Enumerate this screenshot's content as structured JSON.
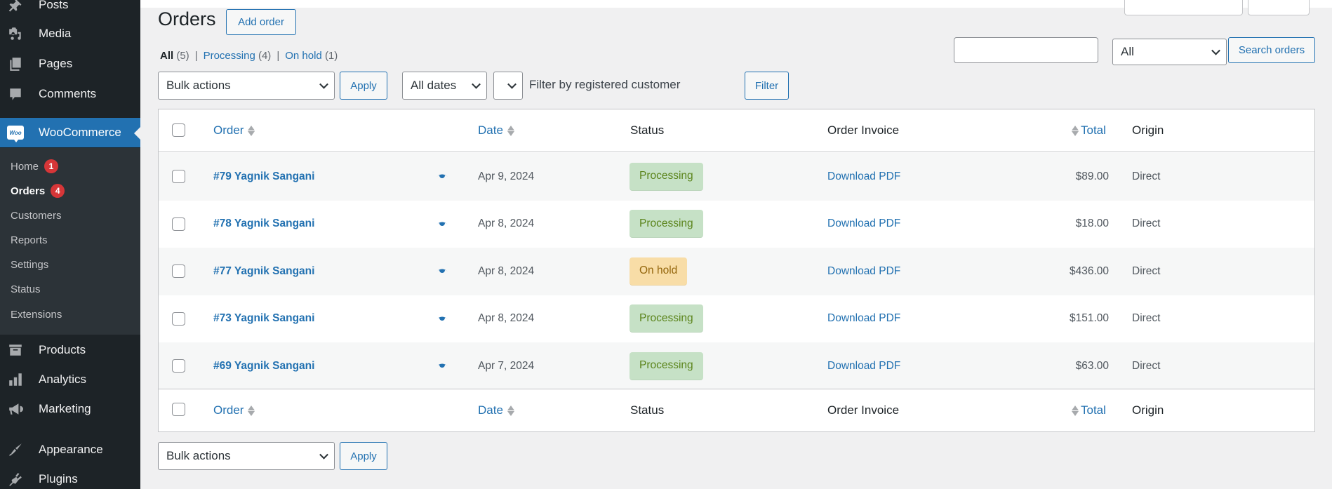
{
  "sidebar": {
    "items_top": [
      {
        "label": "Posts",
        "icon": "pushpin-icon"
      },
      {
        "label": "Media",
        "icon": "media-icon"
      },
      {
        "label": "Pages",
        "icon": "pages-icon"
      },
      {
        "label": "Comments",
        "icon": "comment-icon"
      }
    ],
    "active": {
      "label": "WooCommerce",
      "icon": "woocommerce-icon",
      "logo_text": "Woo"
    },
    "submenu": [
      {
        "label": "Home",
        "badge": "1"
      },
      {
        "label": "Orders",
        "badge": "4",
        "current": true
      },
      {
        "label": "Customers"
      },
      {
        "label": "Reports"
      },
      {
        "label": "Settings"
      },
      {
        "label": "Status"
      },
      {
        "label": "Extensions"
      }
    ],
    "items_bottom": [
      {
        "label": "Products",
        "icon": "archive-icon"
      },
      {
        "label": "Analytics",
        "icon": "bar-chart-icon"
      },
      {
        "label": "Marketing",
        "icon": "megaphone-icon"
      },
      {
        "label": "Appearance",
        "icon": "paintbrush-icon"
      },
      {
        "label": "Plugins",
        "icon": "plugin-icon"
      }
    ]
  },
  "header": {
    "title": "Orders",
    "add_button": "Add order"
  },
  "views": [
    {
      "label": "All",
      "count": "(5)",
      "current": true
    },
    {
      "label": "Processing",
      "count": "(4)"
    },
    {
      "label": "On hold",
      "count": "(1)"
    }
  ],
  "view_separator": "|",
  "toolbar": {
    "bulk_actions": "Bulk actions",
    "apply": "Apply",
    "dates": "All dates",
    "customer_filter_placeholder": "Filter by registered customer",
    "filter": "Filter"
  },
  "search": {
    "value": "",
    "scope": "All",
    "button": "Search orders"
  },
  "table": {
    "columns": {
      "order": "Order",
      "date": "Date",
      "status": "Status",
      "invoice": "Order Invoice",
      "total": "Total",
      "origin": "Origin"
    },
    "rows": [
      {
        "order": "#79 Yagnik Sangani",
        "date": "Apr 9, 2024",
        "status": "Processing",
        "status_key": "processing",
        "invoice": "Download PDF",
        "total": "$89.00",
        "origin": "Direct"
      },
      {
        "order": "#78 Yagnik Sangani",
        "date": "Apr 8, 2024",
        "status": "Processing",
        "status_key": "processing",
        "invoice": "Download PDF",
        "total": "$18.00",
        "origin": "Direct"
      },
      {
        "order": "#77 Yagnik Sangani",
        "date": "Apr 8, 2024",
        "status": "On hold",
        "status_key": "on-hold",
        "invoice": "Download PDF",
        "total": "$436.00",
        "origin": "Direct"
      },
      {
        "order": "#73 Yagnik Sangani",
        "date": "Apr 8, 2024",
        "status": "Processing",
        "status_key": "processing",
        "invoice": "Download PDF",
        "total": "$151.00",
        "origin": "Direct"
      },
      {
        "order": "#69 Yagnik Sangani",
        "date": "Apr 7, 2024",
        "status": "Processing",
        "status_key": "processing",
        "invoice": "Download PDF",
        "total": "$63.00",
        "origin": "Direct"
      }
    ]
  },
  "bottom_toolbar": {
    "bulk_actions": "Bulk actions",
    "apply": "Apply"
  },
  "colors": {
    "accent": "#2271b1",
    "sidebar_bg": "#1d2327",
    "submenu_bg": "#2c3338",
    "badge": "#d63638",
    "processing_bg": "#c6e1c6",
    "processing_text": "#5b841b",
    "on_hold_bg": "#f8dda7",
    "on_hold_text": "#94660c"
  }
}
